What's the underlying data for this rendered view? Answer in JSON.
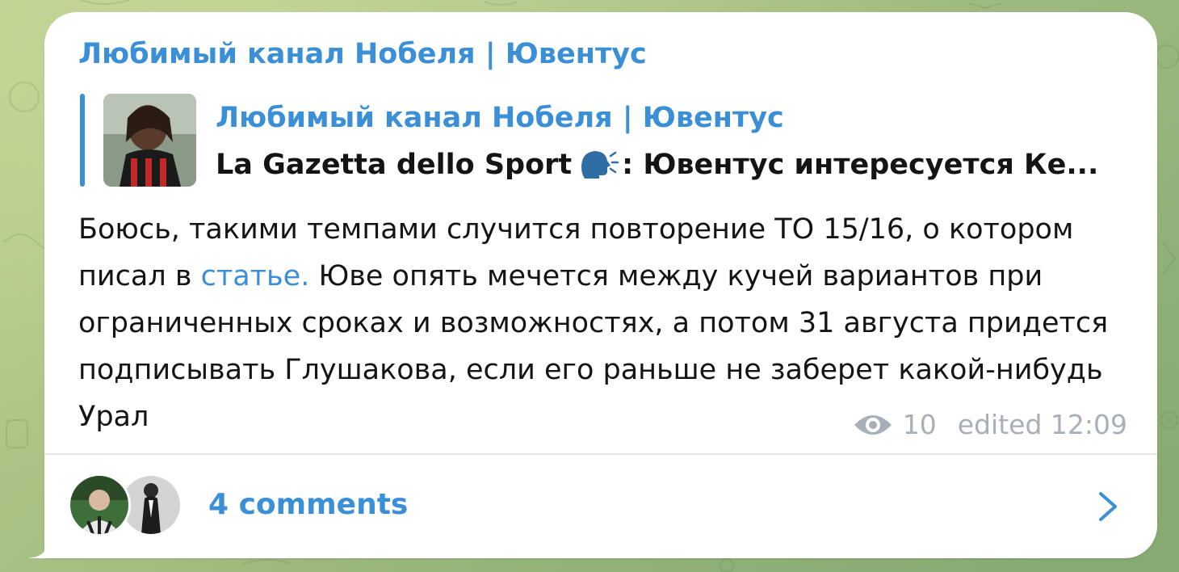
{
  "post": {
    "channel_name": "Любимый канал Нобеля | Ювентус",
    "reply": {
      "title": "Любимый канал Нобеля | Ювентус",
      "text_before_icon": "La Gazetta dello Sport",
      "text_after_icon": ": Ювентус интересуется Ке..."
    },
    "text_part_1": "Боюсь, такими темпами случится повторение ТО 15/16, о котором писал в ",
    "link_text": "статье.",
    "text_part_2": " Юве опять мечется между кучей вариантов при ограниченных сроках и возможностях, а потом 31 августа придется подписывать Глушакова, если его раньше не заберет какой-нибудь Урал",
    "views": "10",
    "edited_label": "edited 12:09",
    "comments_label": "4 comments"
  },
  "icons": {
    "views": "eye-icon",
    "reply_emoji": "speaking-head-icon",
    "comments_open": "chevron-right-icon"
  },
  "colors": {
    "accent": "#3a8fd6",
    "text": "#141414",
    "meta": "#a7b0b8",
    "bubble": "#ffffff",
    "wallpaper": "#a6bf82"
  }
}
